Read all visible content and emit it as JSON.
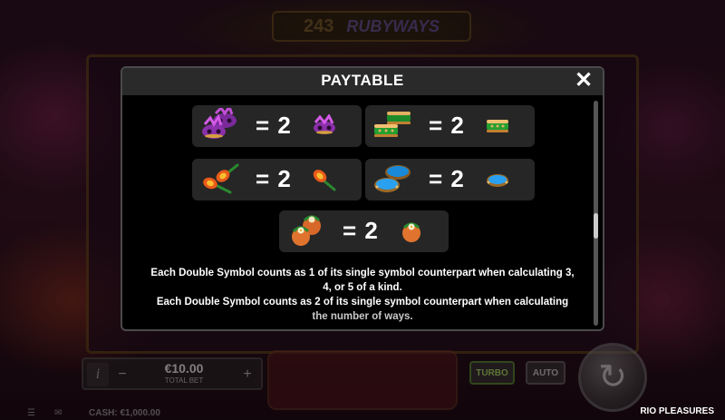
{
  "header": {
    "ways_count": "243",
    "logo_text": "RUBYWAYS"
  },
  "paytable": {
    "title": "PAYTABLE",
    "close_glyph": "✕",
    "items": [
      {
        "symbol": "purple-mask",
        "equals": "= 2"
      },
      {
        "symbol": "green-drum",
        "equals": "= 2"
      },
      {
        "symbol": "maraca",
        "equals": "= 2"
      },
      {
        "symbol": "blue-tambourine",
        "equals": "= 2"
      },
      {
        "symbol": "flower-coconut",
        "equals": "= 2"
      }
    ],
    "description": [
      "Each Double Symbol counts as 1 of its single symbol counterpart when calculating 3,",
      "4, or 5 of a kind.",
      "Each Double Symbol counts as 2 of its single symbol counterpart when calculating",
      "the number of ways."
    ]
  },
  "bottom_bar": {
    "info_glyph": "i",
    "minus_glyph": "−",
    "plus_glyph": "+",
    "bet_value": "€10.00",
    "bet_label": "TOTAL BET",
    "turbo_label": "TURBO",
    "auto_label": "AUTO",
    "spin_glyph": "↻",
    "cash_label": "CASH: €1,000.00",
    "game_name": "RIO PLEASURES"
  },
  "colors": {
    "modal_bg": "#000000",
    "modal_header": "#2a2a2a",
    "symbol_box": "#262626",
    "text": "#ffffff"
  }
}
